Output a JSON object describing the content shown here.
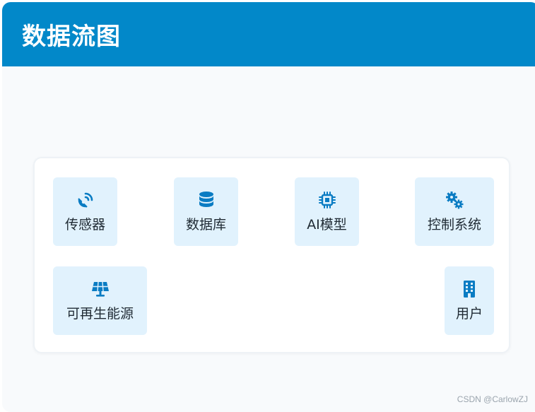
{
  "header": {
    "title": "数据流图"
  },
  "nodes": [
    {
      "id": "sensor",
      "label": "传感器",
      "icon": "satellite-dish-icon"
    },
    {
      "id": "database",
      "label": "数据库",
      "icon": "database-icon"
    },
    {
      "id": "ai-model",
      "label": "AI模型",
      "icon": "microchip-icon"
    },
    {
      "id": "control-system",
      "label": "控制系统",
      "icon": "gears-icon"
    },
    {
      "id": "renewable-energy",
      "label": "可再生能源",
      "icon": "solar-panel-icon"
    },
    {
      "id": "user",
      "label": "用户",
      "icon": "building-icon"
    }
  ],
  "colors": {
    "header_bg": "#0288c9",
    "node_bg": "#e1f2fd",
    "icon": "#0a7cc3",
    "text": "#1f2a33"
  },
  "watermark": "CSDN @CarlowZJ"
}
